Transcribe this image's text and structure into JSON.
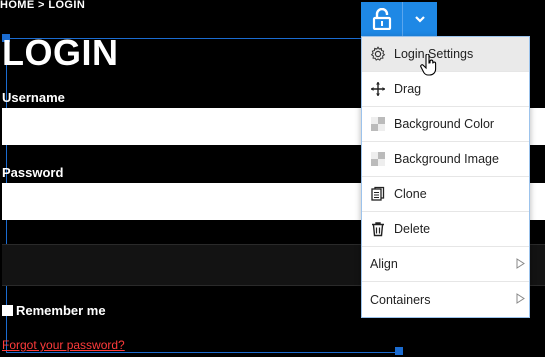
{
  "breadcrumb": "HOME > LOGIN",
  "page": {
    "title": "LOGIN",
    "username_label": "Username",
    "password_label": "Password",
    "remember_label": "Remember me",
    "forgot_link": "Forgot your password?"
  },
  "colors": {
    "accent": "#1e88e5",
    "link": "#ff3b3b",
    "background": "#000000"
  },
  "toolbar": {
    "lock_icon": "unlocked-padlock-icon",
    "dropdown_icon": "chevron-down-icon"
  },
  "menu": {
    "items": [
      {
        "label": "Login Settings",
        "icon": "gear-icon"
      },
      {
        "label": "Drag",
        "icon": "move-arrows-icon"
      },
      {
        "label": "Background Color",
        "icon": "checker-icon"
      },
      {
        "label": "Background Image",
        "icon": "checker-icon"
      },
      {
        "label": "Clone",
        "icon": "clone-icon"
      },
      {
        "label": "Delete",
        "icon": "trash-icon"
      },
      {
        "label": "Align",
        "icon": "submenu-arrow-icon"
      },
      {
        "label": "Containers",
        "icon": "submenu-arrow-icon"
      }
    ]
  }
}
